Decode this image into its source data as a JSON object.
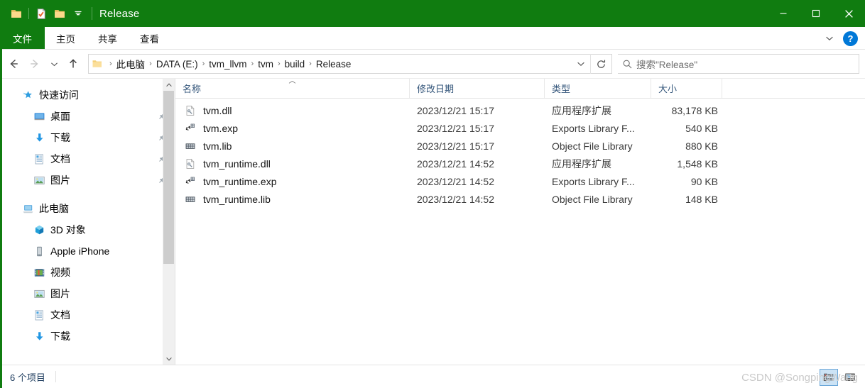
{
  "window": {
    "title": "Release",
    "quick_access_icons": [
      "folder-icon",
      "properties-checklist-icon",
      "new-folder-icon",
      "customize-chevron-icon"
    ],
    "controls": {
      "minimize": "minimize-icon",
      "maximize": "maximize-icon",
      "close": "close-icon"
    }
  },
  "ribbon": {
    "tabs": [
      {
        "label": "文件",
        "active": true
      },
      {
        "label": "主页",
        "active": false
      },
      {
        "label": "共享",
        "active": false
      },
      {
        "label": "查看",
        "active": false
      }
    ],
    "expand_icon": "chevron-down-icon",
    "help_label": "?"
  },
  "navigation": {
    "back": "back-arrow-icon",
    "forward": "forward-arrow-icon",
    "recent": "chevron-down-icon",
    "up": "up-arrow-icon"
  },
  "address": {
    "folder_icon": "folder-icon",
    "crumbs": [
      "此电脑",
      "DATA (E:)",
      "tvm_llvm",
      "tvm",
      "build",
      "Release"
    ],
    "separator": "›",
    "dropdown_icon": "chevron-down-icon",
    "refresh_icon": "refresh-icon"
  },
  "search": {
    "icon": "search-icon",
    "placeholder": "搜索\"Release\""
  },
  "sidebar": {
    "groups": [
      {
        "header": {
          "label": "快速访问",
          "icon": "quick-access-star-icon"
        },
        "items": [
          {
            "label": "桌面",
            "icon": "desktop-icon",
            "pinned": true
          },
          {
            "label": "下载",
            "icon": "downloads-arrow-icon",
            "pinned": true
          },
          {
            "label": "文档",
            "icon": "documents-icon",
            "pinned": true
          },
          {
            "label": "图片",
            "icon": "pictures-icon",
            "pinned": true
          }
        ]
      },
      {
        "header": {
          "label": "此电脑",
          "icon": "this-pc-icon"
        },
        "items": [
          {
            "label": "3D 对象",
            "icon": "3d-objects-icon",
            "pinned": false
          },
          {
            "label": "Apple iPhone",
            "icon": "device-iphone-icon",
            "pinned": false
          },
          {
            "label": "视频",
            "icon": "videos-icon",
            "pinned": false
          },
          {
            "label": "图片",
            "icon": "pictures-icon",
            "pinned": false
          },
          {
            "label": "文档",
            "icon": "documents-icon",
            "pinned": false
          },
          {
            "label": "下载",
            "icon": "downloads-arrow-icon",
            "pinned": false
          }
        ]
      }
    ],
    "scrollbar": {
      "up_icon": "chevron-up-icon",
      "down_icon": "chevron-down-icon"
    }
  },
  "filelist": {
    "columns": [
      {
        "key": "name",
        "label": "名称",
        "sorted": true,
        "sort_dir": "asc"
      },
      {
        "key": "date",
        "label": "修改日期",
        "sorted": false
      },
      {
        "key": "type",
        "label": "类型",
        "sorted": false
      },
      {
        "key": "size",
        "label": "大小",
        "sorted": false
      }
    ],
    "rows": [
      {
        "name": "tvm.dll",
        "date": "2023/12/21 15:17",
        "type": "应用程序扩展",
        "size": "83,178 KB",
        "icon": "dll-file-icon"
      },
      {
        "name": "tvm.exp",
        "date": "2023/12/21 15:17",
        "type": "Exports Library F...",
        "size": "540 KB",
        "icon": "exp-gear-file-icon"
      },
      {
        "name": "tvm.lib",
        "date": "2023/12/21 15:17",
        "type": "Object File Library",
        "size": "880 KB",
        "icon": "lib-file-icon"
      },
      {
        "name": "tvm_runtime.dll",
        "date": "2023/12/21 14:52",
        "type": "应用程序扩展",
        "size": "1,548 KB",
        "icon": "dll-file-icon"
      },
      {
        "name": "tvm_runtime.exp",
        "date": "2023/12/21 14:52",
        "type": "Exports Library F...",
        "size": "90 KB",
        "icon": "exp-gear-file-icon"
      },
      {
        "name": "tvm_runtime.lib",
        "date": "2023/12/21 14:52",
        "type": "Object File Library",
        "size": "148 KB",
        "icon": "lib-file-icon"
      }
    ]
  },
  "statusbar": {
    "item_count": "6 个项目",
    "views": [
      {
        "name": "details-view",
        "active": true
      },
      {
        "name": "large-icons-view",
        "active": false
      }
    ]
  },
  "watermark": "CSDN @SongpingWang",
  "colors": {
    "title_bar": "#107c10",
    "accent": "#0078d7",
    "header_text": "#33557a",
    "selection": "#cce3f5"
  }
}
